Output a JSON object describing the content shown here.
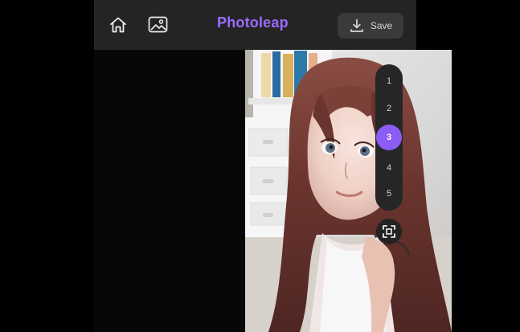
{
  "app": {
    "brand": "Photoleap",
    "accent": "#9b6cff",
    "save_label": "Save"
  },
  "pagination": {
    "items": [
      "1",
      "2",
      "3",
      "4",
      "5"
    ],
    "active": "3"
  },
  "icons": {
    "home": "home-icon",
    "gallery": "image-icon",
    "save": "download-icon",
    "fullscreen": "expand-icon"
  }
}
